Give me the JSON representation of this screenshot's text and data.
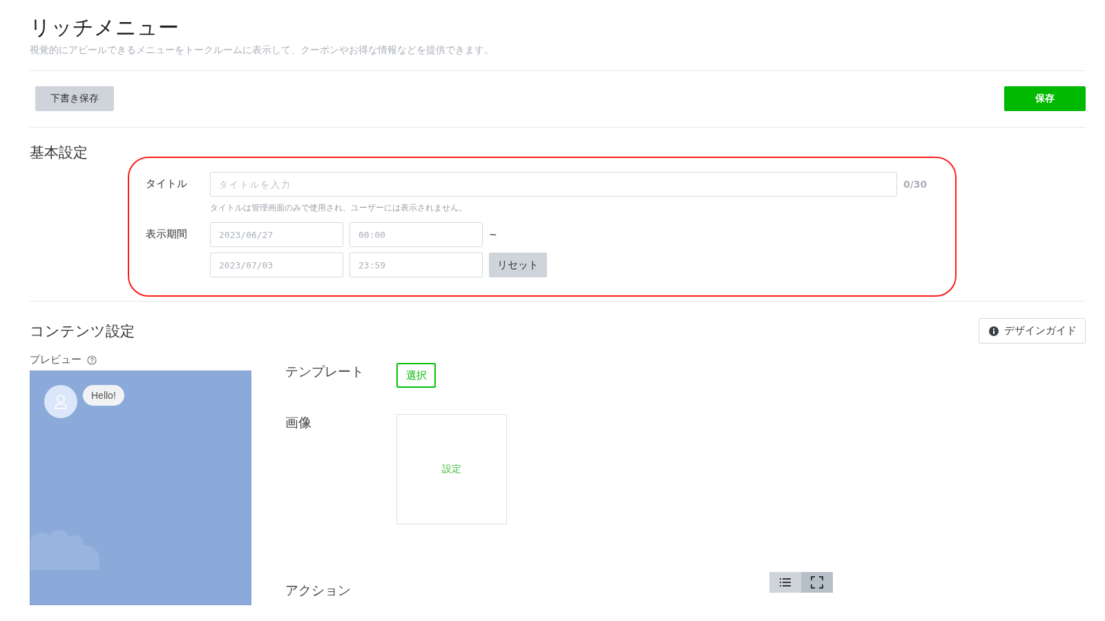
{
  "header": {
    "title": "リッチメニュー",
    "description": "視覚的にアピールできるメニューをトークルームに表示して、クーポンやお得な情報などを提供できます。"
  },
  "toolbar": {
    "draft_button": "下書き保存",
    "save_button": "保存"
  },
  "basic_settings": {
    "heading": "基本設定",
    "highlighted": true,
    "title_field": {
      "label": "タイトル",
      "placeholder": "タイトルを入力",
      "counter": "0/30",
      "hint": "タイトルは管理画面のみで使用され、ユーザーには表示されません。"
    },
    "period": {
      "label": "表示期間",
      "start_date": "2023/06/27",
      "start_time": "00:00",
      "separator": "~",
      "end_date": "2023/07/03",
      "end_time": "23:59",
      "reset_button": "リセット"
    }
  },
  "content_settings": {
    "heading": "コンテンツ設定",
    "design_guide_button": "デザインガイド",
    "preview": {
      "label": "プレビュー",
      "bubble": "Hello!"
    },
    "template": {
      "label": "テンプレート",
      "button": "選択"
    },
    "image": {
      "label": "画像",
      "button": "設定"
    },
    "action": {
      "label": "アクション",
      "views": [
        {
          "kind": "list",
          "selected": false
        },
        {
          "kind": "full",
          "selected": true
        }
      ]
    }
  }
}
